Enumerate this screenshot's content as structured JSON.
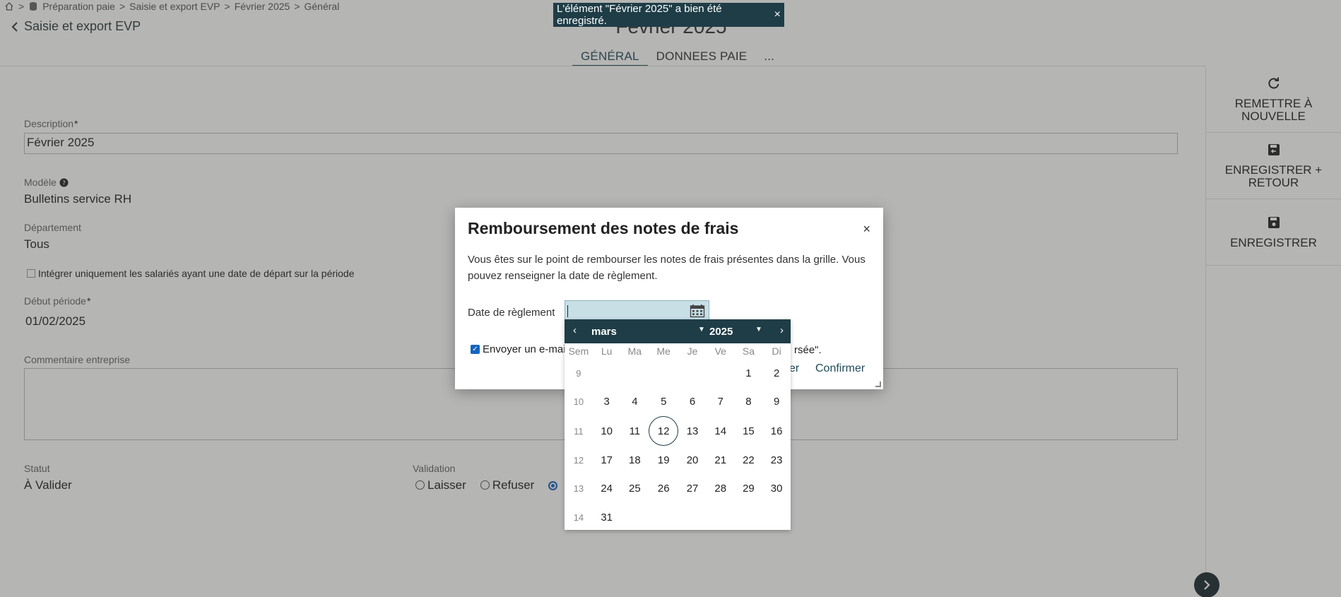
{
  "breadcrumb": {
    "sep": ">",
    "items": [
      "Préparation paie",
      "Saisie et export EVP",
      "Février 2025",
      "Général"
    ]
  },
  "header": {
    "back_label": "Saisie et export EVP",
    "title": "Février 2025",
    "tabs": [
      {
        "label": "GÉNÉRAL",
        "active": true
      },
      {
        "label": "DONNEES PAIE",
        "active": false
      },
      {
        "label": "...",
        "active": false
      }
    ]
  },
  "form": {
    "description_label": "Description",
    "description_value": "Février 2025",
    "required_mark": "*",
    "model_label": "Modèle",
    "model_value": "Bulletins service RH",
    "department_label": "Département",
    "department_value": "Tous",
    "checkbox_label": "Intégrer uniquement les salariés ayant une date de départ sur la période",
    "start_label": "Début période",
    "start_value": "01/02/2025",
    "comment_label": "Commentaire entreprise",
    "status_label": "Statut",
    "status_value": "À Valider",
    "validation_label": "Validation",
    "validation_options": [
      "Laisser",
      "Refuser"
    ]
  },
  "side_actions": [
    {
      "icon": "refresh-icon",
      "label": "REMETTRE À NOUVELLE"
    },
    {
      "icon": "save-return-icon",
      "label": "ENREGISTRER + RETOUR"
    },
    {
      "icon": "save-icon",
      "label": "ENREGISTRER"
    }
  ],
  "toast": {
    "message": "L'élément \"Février 2025\" a bien été enregistré.",
    "close": "×"
  },
  "modal": {
    "title": "Remboursement des notes de frais",
    "close": "×",
    "text": "Vous êtes sur le point de rembourser les notes de frais présentes dans la grille. Vous pouvez renseigner la date de règlement.",
    "date_label": "Date de règlement",
    "date_value": "",
    "email_label_visible": "Envoyer un e-mail",
    "email_label_tail": "rsée\".",
    "cancel_fragment": "er",
    "confirm_label": "Confirmer"
  },
  "datepicker": {
    "month": "mars",
    "year": "2025",
    "headers": [
      "Sem",
      "Lu",
      "Ma",
      "Me",
      "Je",
      "Ve",
      "Sa",
      "Di"
    ],
    "weeks": [
      [
        "9",
        "",
        "",
        "",
        "",
        "",
        "1",
        "2"
      ],
      [
        "10",
        "3",
        "4",
        "5",
        "6",
        "7",
        "8",
        "9"
      ],
      [
        "11",
        "10",
        "11",
        "12",
        "13",
        "14",
        "15",
        "16"
      ],
      [
        "12",
        "17",
        "18",
        "19",
        "20",
        "21",
        "22",
        "23"
      ],
      [
        "13",
        "24",
        "25",
        "26",
        "27",
        "28",
        "29",
        "30"
      ],
      [
        "14",
        "31",
        "",
        "",
        "",
        "",
        "",
        ""
      ]
    ],
    "today": "12"
  },
  "colors": {
    "accent": "#1f3d47",
    "input_highlight": "#c8dfe6",
    "radio_selected": "#1565c0"
  }
}
